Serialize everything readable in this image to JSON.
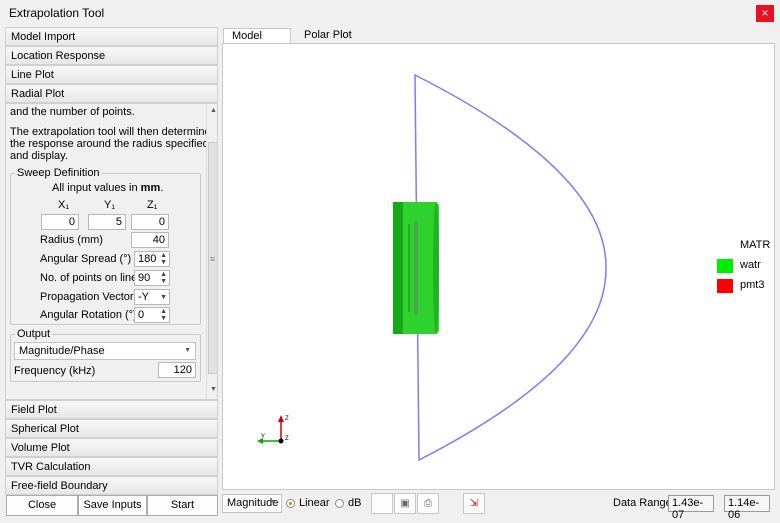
{
  "window": {
    "title": "Extrapolation Tool",
    "close_glyph": "×"
  },
  "accordion_top": [
    "Model Import",
    "Location Response",
    "Line Plot",
    "Radial Plot"
  ],
  "accordion_bottom": [
    "Field Plot",
    "Spherical Plot",
    "Volume Plot",
    "TVR Calculation",
    "Free-field Boundary"
  ],
  "description": {
    "line1": "and the number of points.",
    "line2": "The extrapolation tool will then determine",
    "line3": "the response around the radius specified",
    "line4": "and display."
  },
  "sweep": {
    "title": "Sweep Definition",
    "units_prefix": "All input values in ",
    "units": "mm",
    "units_suffix": ".",
    "x_label": "X₁",
    "y_label": "Y₁",
    "z_label": "Z₁",
    "x_value": "0",
    "y_value": "5",
    "z_value": "0",
    "radius_label": "Radius (mm)",
    "radius_value": "40",
    "spread_label": "Angular Spread (°)",
    "spread_value": "180",
    "points_label": "No. of points on line",
    "points_value": "90",
    "prop_label": "Propagation Vector",
    "prop_value": "-Y",
    "rot_label": "Angular Rotation (°)",
    "rot_value": "0"
  },
  "output": {
    "title": "Output",
    "mode": "Magnitude/Phase",
    "freq_label": "Frequency (kHz)",
    "freq_value": "120"
  },
  "buttons": {
    "close": "Close",
    "save": "Save Inputs",
    "start": "Start"
  },
  "tabs": {
    "model_view": "Model View",
    "polar_plot": "Polar Plot"
  },
  "legend": {
    "title": "MATR",
    "items": [
      {
        "label": "watr",
        "color": "#00ee00"
      },
      {
        "label": "pmt3",
        "color": "#ff0000"
      }
    ]
  },
  "axes": {
    "y": "Y",
    "z": "Z"
  },
  "toolbar": {
    "display": "Magnitude",
    "linear": "Linear",
    "db": "dB",
    "data_range_label": "Data Range",
    "range_min": "1.43e-07",
    "range_max": "1.14e-06"
  },
  "colors": {
    "arc": "#7b7bff",
    "transducer": "#22dd22"
  }
}
